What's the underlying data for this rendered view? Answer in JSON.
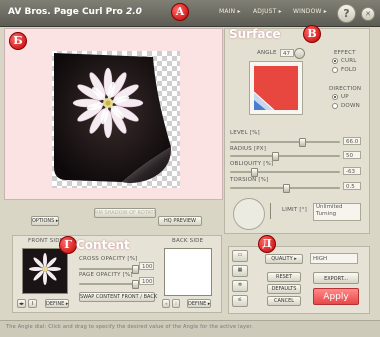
{
  "app": {
    "title": "AV Bros. Page Curl Pro",
    "version": "2.0",
    "menu": [
      "MAIN ▸",
      "ADJUST ▸",
      "WINDOW ▸"
    ],
    "help": "?",
    "close": "✕"
  },
  "markers": {
    "a": "А",
    "b": "Б",
    "v": "В",
    "g": "Г",
    "d": "Д"
  },
  "preview": {
    "options_label": "OPTIONS ▸",
    "hide_label": "RM SHADOW OF ROTATE",
    "hq_label": "HQ PREVIEW"
  },
  "surface": {
    "heading": "Surface",
    "angle_label": "ANGLE",
    "angle_value": "47",
    "effect_label": "EFFECT",
    "effect_options": [
      "CURL",
      "FOLD"
    ],
    "effect_selected": 0,
    "direction_label": "DIRECTION",
    "direction_options": [
      "UP",
      "DOWN"
    ],
    "direction_selected": 0,
    "sliders": [
      {
        "label": "LEVEL [%]",
        "value": "66.0",
        "fraction": 0.66
      },
      {
        "label": "RADIUS [PX]",
        "value": "50",
        "fraction": 0.4
      },
      {
        "label": "OBLIQUITY [%]",
        "value": "-63",
        "fraction": 0.2
      },
      {
        "label": "TORSION [%]",
        "value": "0.5",
        "fraction": 0.5
      }
    ],
    "limit_label": "LIMIT [°]",
    "limit_value": "Unlimited\nTurning"
  },
  "content": {
    "heading": "Content",
    "front_label": "FRONT SIDE",
    "back_label": "BACK SIDE",
    "cross_opacity_label": "CROSS OPACITY [%]",
    "cross_opacity_value": "100",
    "page_opacity_label": "PAGE OPACITY [%]",
    "page_opacity_value": "100",
    "swap_label": "SWAP CONTENT FRONT / BACK",
    "define_front": "DEFINE ▸",
    "define_back": "DEFINE ▸"
  },
  "bottom": {
    "quality_label": "QUALITY ▸",
    "quality_value": "HIGH",
    "reset": "RESET",
    "defaults": "DEFAULTS",
    "cancel": "CANCEL",
    "export": "EXPORT...",
    "apply": "Apply"
  },
  "status": "The Angle dial: Click and drag to specify the desired value of the Angle for the active layer."
}
